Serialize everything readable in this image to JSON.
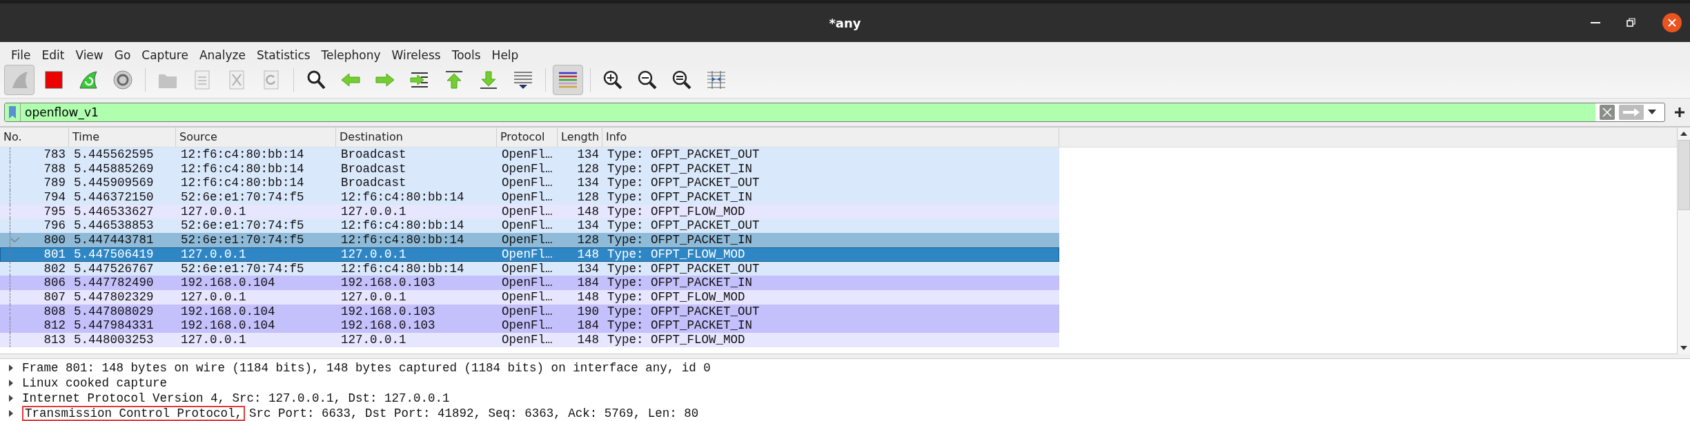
{
  "window": {
    "title": "*any"
  },
  "menu": [
    "File",
    "Edit",
    "View",
    "Go",
    "Capture",
    "Analyze",
    "Statistics",
    "Telephony",
    "Wireless",
    "Tools",
    "Help"
  ],
  "toolbar": [
    [
      {
        "kind": "start",
        "disabled": true,
        "pressed": true
      },
      {
        "kind": "stop",
        "disabled": false,
        "pressed": false
      },
      {
        "kind": "restart",
        "disabled": false,
        "pressed": false
      },
      {
        "kind": "options",
        "disabled": false,
        "pressed": false
      }
    ],
    [
      {
        "kind": "open",
        "disabled": true,
        "pressed": false
      },
      {
        "kind": "save",
        "disabled": true,
        "pressed": false
      },
      {
        "kind": "close",
        "disabled": true,
        "pressed": false
      },
      {
        "kind": "reload",
        "disabled": true,
        "pressed": false
      }
    ],
    [
      {
        "kind": "find",
        "disabled": false,
        "pressed": false
      },
      {
        "kind": "back",
        "disabled": false,
        "pressed": false
      },
      {
        "kind": "forward",
        "disabled": false,
        "pressed": false
      },
      {
        "kind": "goto",
        "disabled": false,
        "pressed": false
      },
      {
        "kind": "first",
        "disabled": false,
        "pressed": false
      },
      {
        "kind": "last",
        "disabled": false,
        "pressed": false
      },
      {
        "kind": "autoscroll",
        "disabled": false,
        "pressed": false
      }
    ],
    [
      {
        "kind": "colorize",
        "disabled": false,
        "pressed": true
      }
    ],
    [
      {
        "kind": "zoom-in",
        "disabled": false,
        "pressed": false
      },
      {
        "kind": "zoom-out",
        "disabled": false,
        "pressed": false
      },
      {
        "kind": "zoom-reset",
        "disabled": false,
        "pressed": false
      },
      {
        "kind": "resize-columns",
        "disabled": false,
        "pressed": false
      }
    ]
  ],
  "filter": {
    "value": "openflow_v1",
    "valid": true
  },
  "table": {
    "columns": [
      "No.",
      "Time",
      "Source",
      "Destination",
      "Protocol",
      "Length",
      "Info"
    ],
    "rows": [
      {
        "cells": [
          "783",
          "5.445562595",
          "12:f6:c4:80:bb:14",
          "Broadcast",
          "OpenFl…",
          "134",
          "Type: OFPT_PACKET_OUT"
        ],
        "color": "#dae8fc",
        "selected": false,
        "related": false
      },
      {
        "cells": [
          "788",
          "5.445885269",
          "12:f6:c4:80:bb:14",
          "Broadcast",
          "OpenFl…",
          "128",
          "Type: OFPT_PACKET_IN"
        ],
        "color": "#dae8fc",
        "selected": false,
        "related": false
      },
      {
        "cells": [
          "789",
          "5.445909569",
          "12:f6:c4:80:bb:14",
          "Broadcast",
          "OpenFl…",
          "134",
          "Type: OFPT_PACKET_OUT"
        ],
        "color": "#dae8fc",
        "selected": false,
        "related": false
      },
      {
        "cells": [
          "794",
          "5.446372150",
          "52:6e:e1:70:74:f5",
          "12:f6:c4:80:bb:14",
          "OpenFl…",
          "128",
          "Type: OFPT_PACKET_IN"
        ],
        "color": "#dae8fc",
        "selected": false,
        "related": false
      },
      {
        "cells": [
          "795",
          "5.446533627",
          "127.0.0.1",
          "127.0.0.1",
          "OpenFl…",
          "148",
          "Type: OFPT_FLOW_MOD"
        ],
        "color": "#e7e6ff",
        "selected": false,
        "related": false
      },
      {
        "cells": [
          "796",
          "5.446538853",
          "52:6e:e1:70:74:f5",
          "12:f6:c4:80:bb:14",
          "OpenFl…",
          "134",
          "Type: OFPT_PACKET_OUT"
        ],
        "color": "#dae8fc",
        "selected": false,
        "related": false
      },
      {
        "cells": [
          "800",
          "5.447443781",
          "52:6e:e1:70:74:f5",
          "12:f6:c4:80:bb:14",
          "OpenFl…",
          "128",
          "Type: OFPT_PACKET_IN"
        ],
        "color": "#8fbbd9",
        "selected": false,
        "related": true
      },
      {
        "cells": [
          "801",
          "5.447506419",
          "127.0.0.1",
          "127.0.0.1",
          "OpenFl…",
          "148",
          "Type: OFPT_FLOW_MOD"
        ],
        "color": "#2e86c4",
        "selected": true,
        "related": false
      },
      {
        "cells": [
          "802",
          "5.447526767",
          "52:6e:e1:70:74:f5",
          "12:f6:c4:80:bb:14",
          "OpenFl…",
          "134",
          "Type: OFPT_PACKET_OUT"
        ],
        "color": "#dae8fc",
        "selected": false,
        "related": false
      },
      {
        "cells": [
          "806",
          "5.447782490",
          "192.168.0.104",
          "192.168.0.103",
          "OpenFl…",
          "184",
          "Type: OFPT_PACKET_IN"
        ],
        "color": "#c4c0fc",
        "selected": false,
        "related": false
      },
      {
        "cells": [
          "807",
          "5.447802329",
          "127.0.0.1",
          "127.0.0.1",
          "OpenFl…",
          "148",
          "Type: OFPT_FLOW_MOD"
        ],
        "color": "#e7e6ff",
        "selected": false,
        "related": false
      },
      {
        "cells": [
          "808",
          "5.447808029",
          "192.168.0.104",
          "192.168.0.103",
          "OpenFl…",
          "190",
          "Type: OFPT_PACKET_OUT"
        ],
        "color": "#c4c0fc",
        "selected": false,
        "related": false
      },
      {
        "cells": [
          "812",
          "5.447984331",
          "192.168.0.104",
          "192.168.0.103",
          "OpenFl…",
          "184",
          "Type: OFPT_PACKET_IN"
        ],
        "color": "#c4c0fc",
        "selected": false,
        "related": false
      },
      {
        "cells": [
          "813",
          "5.448003253",
          "127.0.0.1",
          "127.0.0.1",
          "OpenFl…",
          "148",
          "Type: OFPT_FLOW_MOD"
        ],
        "color": "#e7e6ff",
        "selected": false,
        "related": false
      }
    ]
  },
  "details": [
    {
      "text": "Frame 801: 148 bytes on wire (1184 bits), 148 bytes captured (1184 bits) on interface any, id 0",
      "expanded": false
    },
    {
      "text": "Linux cooked capture",
      "expanded": false
    },
    {
      "text": "Internet Protocol Version 4, Src: 127.0.0.1, Dst: 127.0.0.1",
      "expanded": false
    },
    {
      "boxed": "Transmission Control Protocol,",
      "text": "Src Port: 6633, Dst Port: 41892, Seq: 6363, Ack: 5769, Len: 80",
      "expanded": false
    }
  ]
}
